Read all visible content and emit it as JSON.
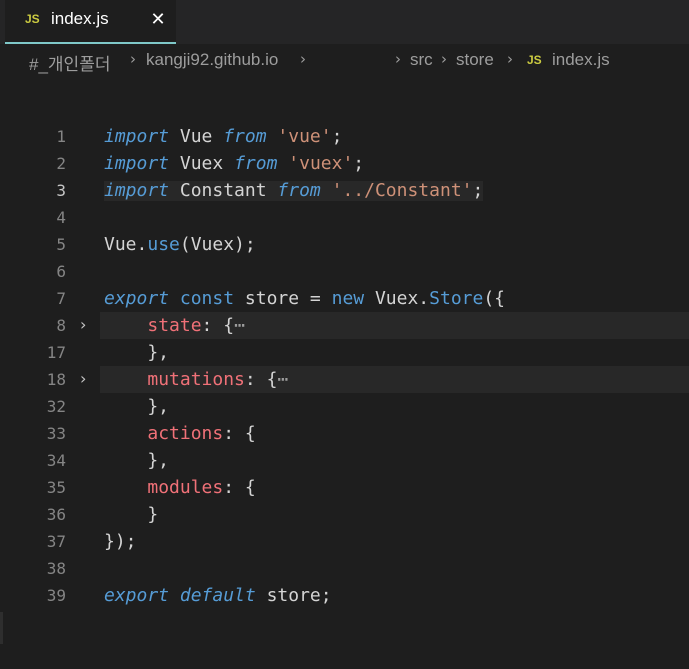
{
  "tab": {
    "badge": "JS",
    "filename": "index.js",
    "close": "✕"
  },
  "breadcrumb": {
    "folder": "#_개인폴더",
    "repo": "kangji92.github.io",
    "src": "src",
    "store": "store",
    "file_badge": "JS",
    "file": "index.js",
    "separator": "›"
  },
  "editor": {
    "line_numbers": [
      "1",
      "2",
      "3",
      "4",
      "5",
      "6",
      "7",
      "8",
      "17",
      "18",
      "32",
      "33",
      "34",
      "35",
      "36",
      "37",
      "38",
      "39"
    ],
    "fold_icon": "›",
    "folded_placeholder": "⋯"
  },
  "colors": {
    "keyword": "#569cd6",
    "string": "#ce9178",
    "property": "#f07178",
    "accent": "#7fc8c9",
    "js_badge": "#cbcb41"
  }
}
